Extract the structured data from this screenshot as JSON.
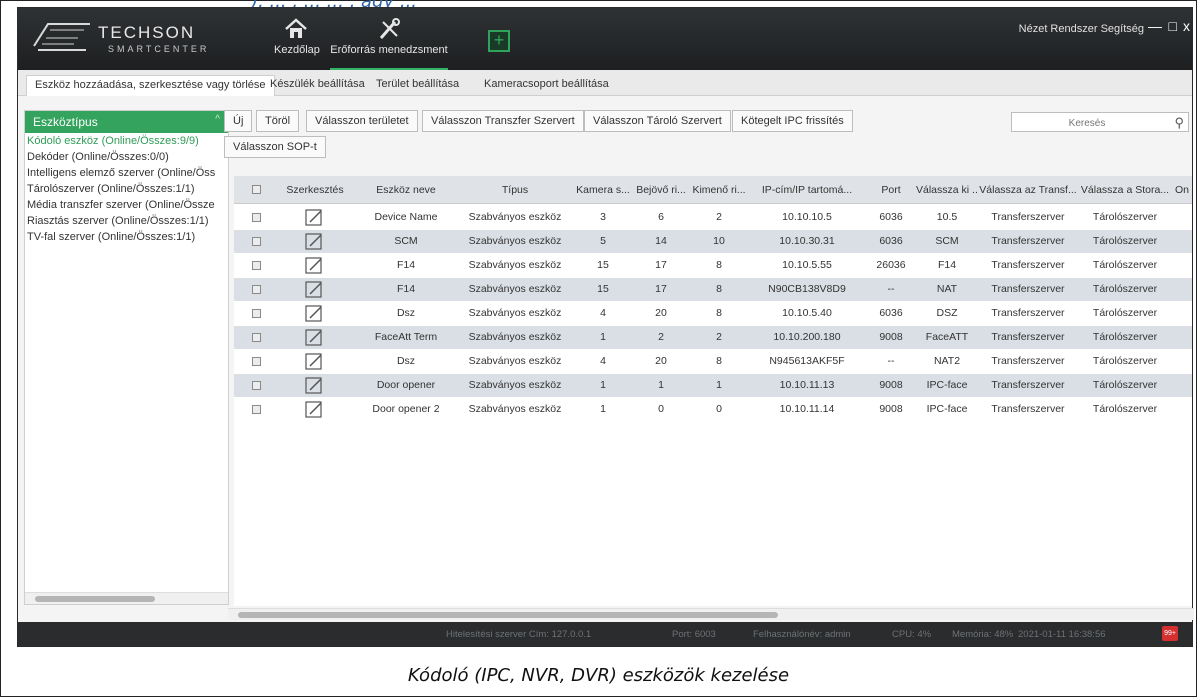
{
  "header_text": "), ... , ... ... , agy ...",
  "app": {
    "logo_main": "TECHSON",
    "logo_sub": "SMARTCENTER",
    "nav": [
      {
        "label": "Kezdőlap",
        "icon": "home-icon"
      },
      {
        "label": "Erőforrás menedzsment",
        "icon": "tools-icon"
      }
    ],
    "menu": "Nézet Rendszer Segítség",
    "window_controls": [
      "—",
      "□",
      "x"
    ]
  },
  "tabs": [
    "Eszköz hozzáadása, szerkesztése vagy törlése",
    "Készülék beállítása",
    "Terület beállítása",
    "Kameracsoport beállítása"
  ],
  "sidebar": {
    "title": "Eszköztípus",
    "items": [
      "Kódoló eszköz (Online/Összes:9/9)",
      "Dekóder (Online/Összes:0/0)",
      "Intelligens elemző szerver (Online/Öss",
      "Tárolószerver (Online/Összes:1/1)",
      "Média transzfer szerver (Online/Össze",
      "Riasztás szerver (Online/Összes:1/1)",
      "TV-fal szerver (Online/Összes:1/1)"
    ]
  },
  "toolbar": {
    "buttons": [
      "Új",
      "Töröl",
      "Válasszon területet",
      "Válasszon Transzfer Szervert",
      "Válasszon Tároló Szervert",
      "Kötegelt IPC frissítés"
    ],
    "sop_button": "Válasszon SOP-t",
    "search_placeholder": "Keresés"
  },
  "table": {
    "columns": [
      "",
      "Szerkesztés",
      "Eszköz neve",
      "Típus",
      "Kamera s...",
      "Bejövő ri...",
      "Kimenő ri...",
      "IP-cím/IP tartomá...",
      "Port",
      "Válassza ki ...",
      "Válassza az Transf...",
      "Válassza a Stora...",
      "On"
    ],
    "rows": [
      [
        "Device Name",
        "Szabványos eszköz",
        "3",
        "6",
        "2",
        "10.10.10.5",
        "6036",
        "10.5",
        "Transferszerver",
        "Tárolószerver"
      ],
      [
        "SCM",
        "Szabványos eszköz",
        "5",
        "14",
        "10",
        "10.10.30.31",
        "6036",
        "SCM",
        "Transferszerver",
        "Tárolószerver"
      ],
      [
        "F14",
        "Szabványos eszköz",
        "15",
        "17",
        "8",
        "10.10.5.55",
        "26036",
        "F14",
        "Transferszerver",
        "Tárolószerver"
      ],
      [
        "F14",
        "Szabványos eszköz",
        "15",
        "17",
        "8",
        "N90CB138V8D9",
        "--",
        "NAT",
        "Transferszerver",
        "Tárolószerver"
      ],
      [
        "Dsz",
        "Szabványos eszköz",
        "4",
        "20",
        "8",
        "10.10.5.40",
        "6036",
        "DSZ",
        "Transferszerver",
        "Tárolószerver"
      ],
      [
        "FaceAtt Term",
        "Szabványos eszköz",
        "1",
        "2",
        "2",
        "10.10.200.180",
        "9008",
        "FaceATT",
        "Transferszerver",
        "Tárolószerver"
      ],
      [
        "Dsz",
        "Szabványos eszköz",
        "4",
        "20",
        "8",
        "N945613AKF5F",
        "--",
        "NAT2",
        "Transferszerver",
        "Tárolószerver"
      ],
      [
        "Door opener",
        "Szabványos eszköz",
        "1",
        "1",
        "1",
        "10.10.11.13",
        "9008",
        "IPC-face",
        "Transferszerver",
        "Tárolószerver"
      ],
      [
        "Door opener 2",
        "Szabványos eszköz",
        "1",
        "0",
        "0",
        "10.10.11.14",
        "9008",
        "IPC-face",
        "Transferszerver",
        "Tárolószerver"
      ]
    ]
  },
  "status": {
    "server": "Hitelesítési szerver Cím: 127.0.0.1",
    "port": "Port: 6003",
    "user": "Felhasználónév: admin",
    "cpu": "CPU: 4%",
    "memory": "Memória: 48%",
    "datetime": "2021-01-11 16:38:56",
    "badge": "99+"
  },
  "caption": "Kódoló (IPC, NVR, DVR) eszközök kezelése",
  "colors": {
    "accent": "#34a35e",
    "titlebar": "#26292b"
  }
}
